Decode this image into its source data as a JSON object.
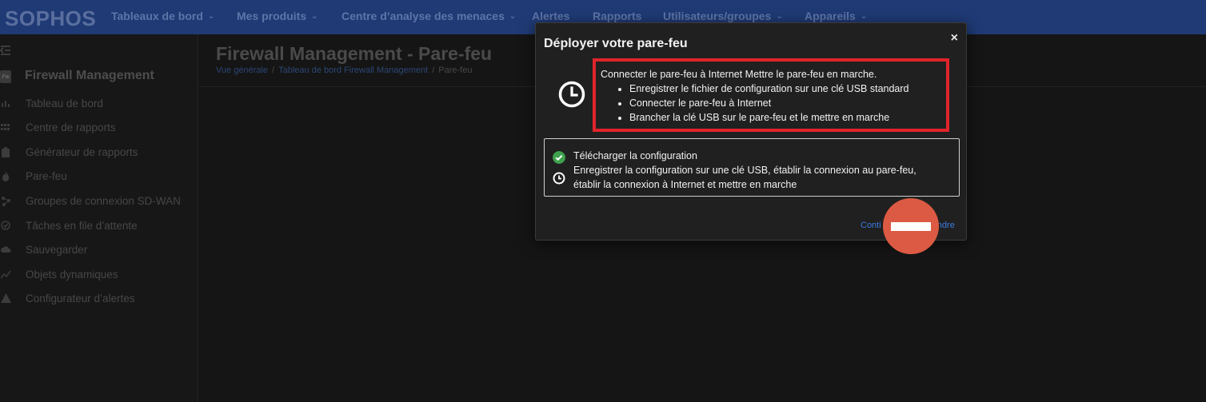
{
  "topnav": {
    "logo": "SOPHOS",
    "items": [
      {
        "label": "Tableaux de bord",
        "dropdown": true
      },
      {
        "label": "Mes produits",
        "dropdown": true
      },
      {
        "label": "Centre d’analyse des menaces",
        "dropdown": true
      },
      {
        "label": "Alertes",
        "dropdown": false
      },
      {
        "label": "Rapports",
        "dropdown": false
      },
      {
        "label": "Utilisateurs/groupes",
        "dropdown": true
      },
      {
        "label": "Appareils",
        "dropdown": true
      }
    ],
    "chevron": "⌄"
  },
  "sidebar": {
    "badge": "Fw",
    "title": "Firewall Management",
    "items": [
      {
        "label": "Tableau de bord",
        "icon": "bar-chart-icon"
      },
      {
        "label": "Centre de rapports",
        "icon": "grid-icon"
      },
      {
        "label": "Générateur de rapports",
        "icon": "clipboard-icon"
      },
      {
        "label": "Pare-feu",
        "icon": "flame-icon"
      },
      {
        "label": "Groupes de connexion SD-WAN",
        "icon": "network-icon"
      },
      {
        "label": "Tâches en file d’attente",
        "icon": "check-circle-icon"
      },
      {
        "label": "Sauvegarder",
        "icon": "cloud-icon"
      },
      {
        "label": "Objets dynamiques",
        "icon": "trend-icon"
      },
      {
        "label": "Configurateur d’alertes",
        "icon": "warning-icon"
      }
    ]
  },
  "page": {
    "title": "Firewall Management - Pare-feu",
    "breadcrumb": [
      "Vue générale",
      "Tableau de bord Firewall Management",
      "Pare-feu"
    ],
    "separator": "/"
  },
  "modal": {
    "title": "Déployer votre pare-feu",
    "close": "×",
    "step_heading": "Connecter le pare-feu à Internet Mettre le pare-feu en marche.",
    "step_bullets": [
      "Enregistrer le fichier de configuration sur une clé USB standard",
      "Connecter le pare-feu à Internet",
      "Brancher la clé USB sur le pare-feu et le mettre en marche"
    ],
    "status_done": "Télécharger la configuration",
    "status_pending_line1": "Enregistrer la configuration sur une clé USB, établir la connexion au pare-feu,",
    "status_pending_line2": "établir la connexion à Internet et mettre en marche",
    "continue_left": "Conti",
    "continue_right": "endre"
  },
  "colors": {
    "nav_bg": "#1f3a75",
    "highlight": "#e0242b",
    "success": "#3fa14d",
    "link": "#3b7be0",
    "redaction": "#dc5a43"
  }
}
